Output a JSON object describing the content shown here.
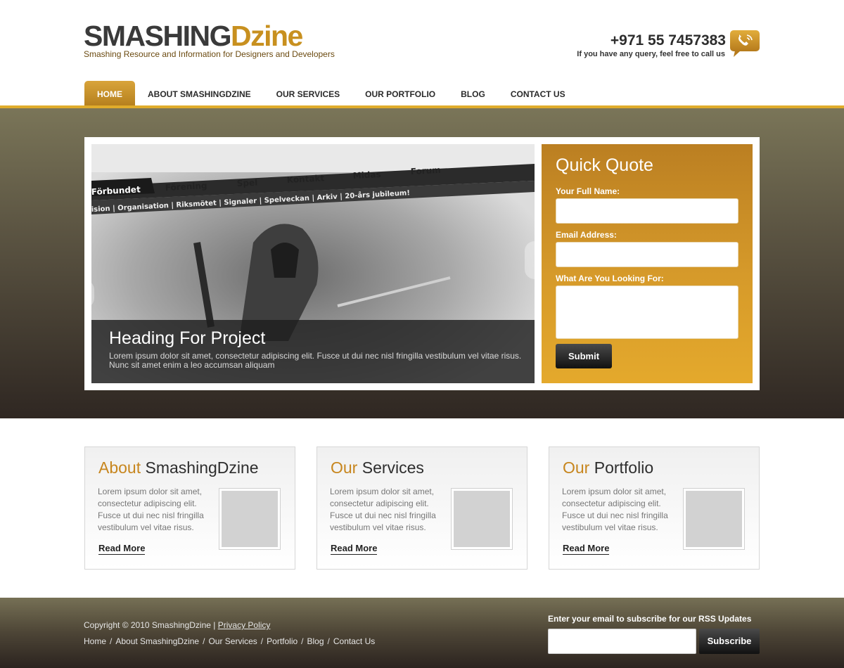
{
  "header": {
    "logo_part1": "SMASHING",
    "logo_part2": "Dzine",
    "tagline": "Smashing Resource and Information for Designers and Developers",
    "phone": "+971 55 7457383",
    "phone_sub": "If you have any query, feel free to call us",
    "phone_icon": "phone-icon"
  },
  "nav": {
    "items": [
      {
        "label": "HOME",
        "active": true
      },
      {
        "label": "ABOUT SMASHINGDZINE"
      },
      {
        "label": "OUR SERVICES"
      },
      {
        "label": "OUR PORTFOLIO"
      },
      {
        "label": "BLOG"
      },
      {
        "label": "CONTACT US"
      }
    ]
  },
  "slider": {
    "title": "Heading For Project",
    "text": "Lorem ipsum dolor sit amet, consectetur adipiscing elit. Fusce ut dui nec nisl fringilla vestibulum vel vitae risus. Nunc sit amet enim a leo accumsan aliquam",
    "screenshot_tabs": [
      "Förbundet",
      "Förening",
      "Spel",
      "Kontakt",
      "Midas",
      "Forum"
    ],
    "screenshot_subnav": "ision | Organisation | Riksmötet | Signaler | Spelveckan | Arkiv | 20-års jubileum!"
  },
  "quote": {
    "title": "Quick Quote",
    "name_label": "Your Full Name:",
    "email_label": "Email Address:",
    "looking_label": "What Are You Looking For:",
    "submit": "Submit"
  },
  "boxes": [
    {
      "accent": "About",
      "title": " SmashingDzine",
      "text": "Lorem ipsum dolor sit amet, consectetur adipiscing elit. Fusce ut dui nec nisl fringilla vestibulum vel vitae risus.",
      "read_more": "Read More"
    },
    {
      "accent": "Our",
      "title": " Services",
      "text": "Lorem ipsum dolor sit amet, consectetur adipiscing elit. Fusce ut dui nec nisl fringilla vestibulum vel vitae risus.",
      "read_more": "Read More"
    },
    {
      "accent": "Our",
      "title": " Portfolio",
      "text": "Lorem ipsum dolor sit amet, consectetur adipiscing elit. Fusce ut dui nec nisl fringilla vestibulum vel vitae risus.",
      "read_more": "Read More"
    }
  ],
  "footer": {
    "copyright": "Copyright © 2010 SmashingDzine  |",
    "privacy": "Privacy Policy",
    "links": [
      "Home",
      "About SmashingDzine",
      "Our Services",
      "Portfolio",
      "Blog",
      "Contact Us"
    ],
    "rss_label": "Enter your email to subscribe for our RSS Updates",
    "subscribe": "Subscribe"
  },
  "colors": {
    "accent": "#c8901f",
    "nav_line": "#e0ac2b",
    "quote_top": "#bb7f22",
    "quote_bottom": "#e4a92c"
  }
}
